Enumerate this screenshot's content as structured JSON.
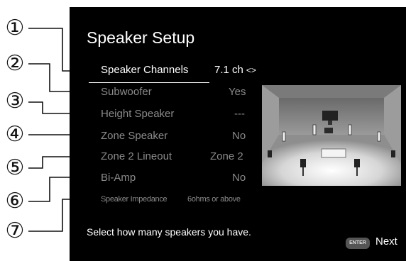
{
  "callouts": [
    "①",
    "②",
    "③",
    "④",
    "⑤",
    "⑥",
    "⑦"
  ],
  "screen": {
    "title": "Speaker Setup",
    "settings": [
      {
        "label": "Speaker Channels",
        "value": "7.1 ch",
        "arrows": "<>",
        "selected": true
      },
      {
        "label": "Subwoofer",
        "value": "Yes"
      },
      {
        "label": "Height Speaker",
        "value": "---"
      },
      {
        "label": "Zone Speaker",
        "value": "No"
      },
      {
        "label": "Zone 2 Lineout",
        "value": "Zone 2"
      },
      {
        "label": "Bi-Amp",
        "value": "No"
      },
      {
        "label": "Speaker Impedance",
        "value": "6ohms or above"
      }
    ],
    "help_text": "Select how many speakers you have.",
    "enter_key_label": "ENTER",
    "next_label": "Next"
  }
}
